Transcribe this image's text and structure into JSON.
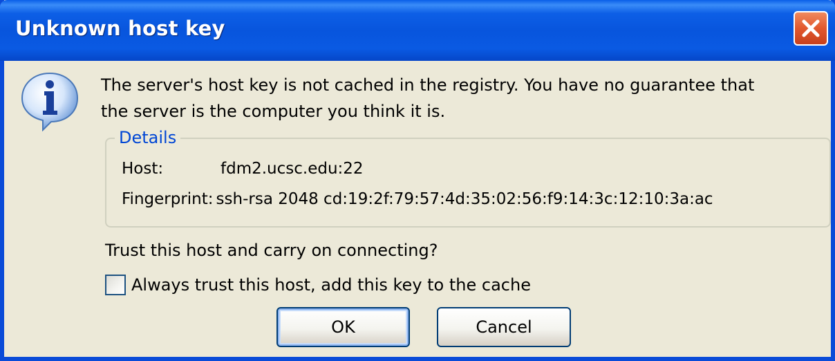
{
  "window": {
    "title": "Unknown host key"
  },
  "icons": {
    "info": "information-icon",
    "close": "close-icon"
  },
  "message": {
    "line1": "The server's host key is not cached in the registry. You have no guarantee that",
    "line2": "the server is the computer you think it is."
  },
  "details": {
    "legend": "Details",
    "host_label": "Host:",
    "host_value": "fdm2.ucsc.edu:22",
    "fingerprint_label": "Fingerprint:",
    "fingerprint_value": "ssh-rsa 2048 cd:19:2f:79:57:4d:35:02:56:f9:14:3c:12:10:3a:ac"
  },
  "question": "Trust this host and carry on connecting?",
  "checkbox": {
    "label": "Always trust this host, add this key to the cache",
    "checked": false
  },
  "buttons": {
    "ok": "OK",
    "cancel": "Cancel"
  },
  "colors": {
    "titlebar": "#0855dd",
    "dialog_bg": "#ece9d8",
    "close_button": "#e2582e",
    "group_legend": "#0046d5"
  }
}
